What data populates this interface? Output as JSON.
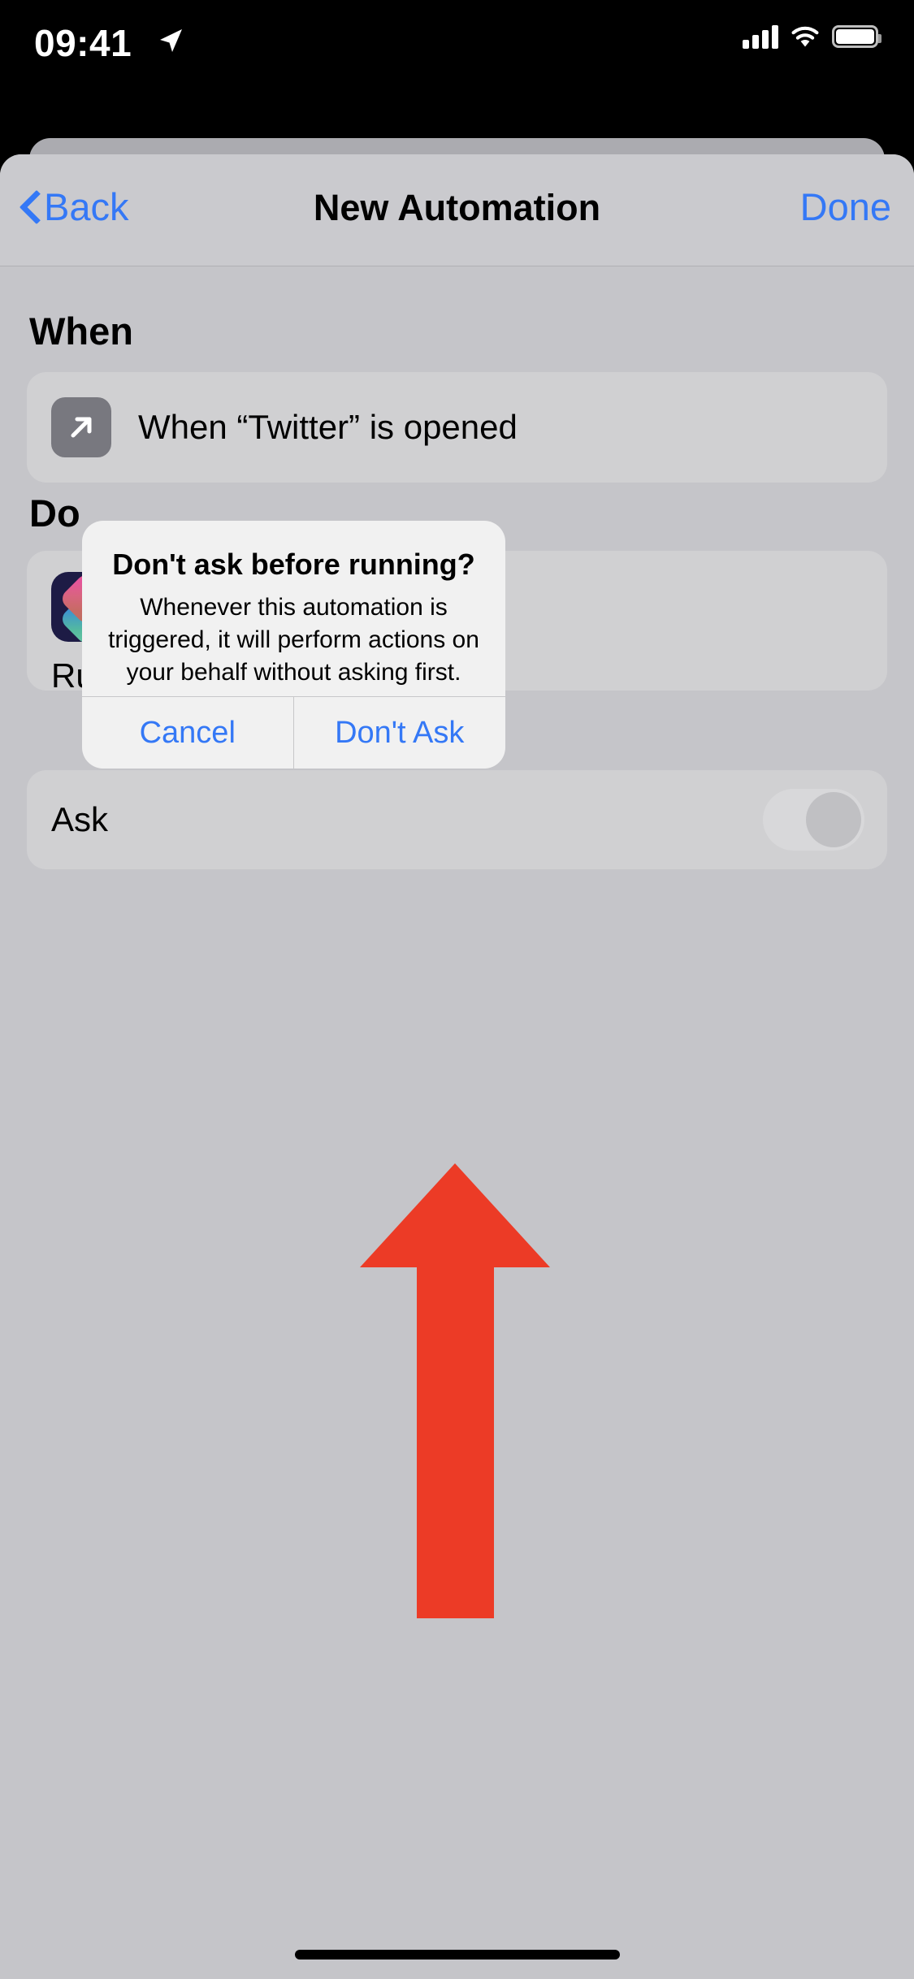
{
  "status_bar": {
    "time": "09:41",
    "location_icon": "location-arrow-icon",
    "cellular_icon": "signal-bars-icon",
    "wifi_icon": "wifi-icon",
    "battery_icon": "battery-icon"
  },
  "nav": {
    "back_label": "Back",
    "back_icon": "chevron-left-icon",
    "title": "New Automation",
    "done_label": "Done"
  },
  "sections": {
    "when": {
      "header": "When",
      "trigger": {
        "icon": "arrow-up-right-icon",
        "label": "When “Twitter” is opened"
      }
    },
    "do": {
      "header": "Do",
      "action": {
        "icon": "shortcuts-app-icon",
        "label": "Run"
      },
      "ask_before_running": {
        "label": "Ask",
        "toggle_icon": "toggle-switch-icon",
        "toggle_state": "off"
      }
    }
  },
  "alert": {
    "title": "Don't ask before running?",
    "message": "Whenever this automation is triggered, it will perform actions on your behalf without asking first.",
    "cancel_label": "Cancel",
    "confirm_label": "Don't Ask"
  },
  "annotation": {
    "arrow_icon": "red-arrow-up-icon",
    "color": "#ec3b26",
    "points_to": "Don't Ask"
  },
  "colors": {
    "accent_blue": "#3478f6",
    "sheet_background": "#c5c5c9",
    "nav_background": "#cacace",
    "card_background": "#d0d0d2",
    "alert_background": "#f1f1f1",
    "annotation_red": "#ec3b26"
  },
  "home_indicator": "home-indicator"
}
